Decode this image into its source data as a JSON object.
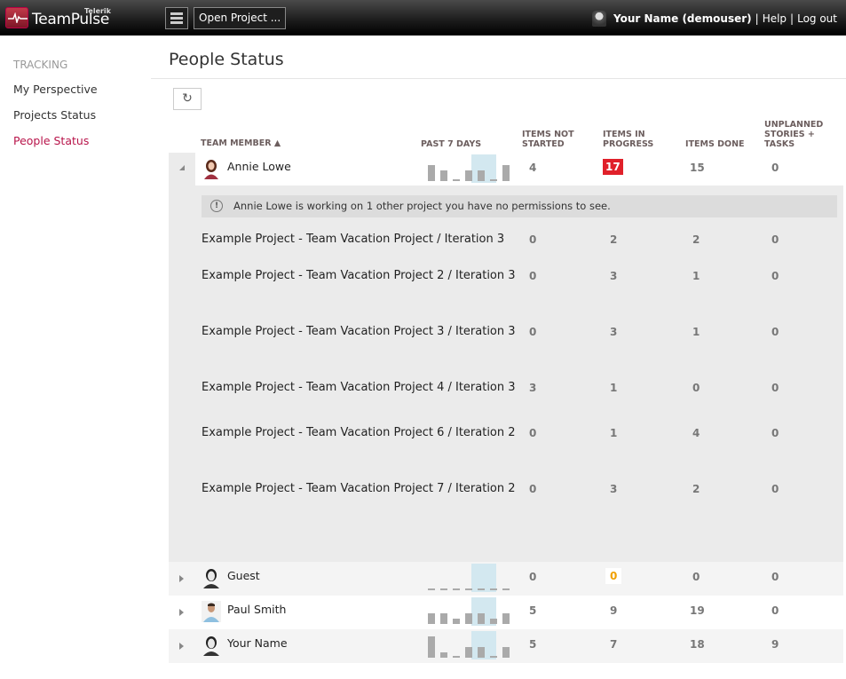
{
  "topbar": {
    "brand": "TeamPulse",
    "brand_sub": "Telerik",
    "open_project": "Open Project ...",
    "user": "Your Name (demouser)",
    "sep": "|",
    "help": "Help",
    "logout": "Log out"
  },
  "sidebar": {
    "heading": "TRACKING",
    "items": [
      {
        "label": "My Perspective"
      },
      {
        "label": "Projects Status"
      },
      {
        "label": "People Status",
        "active": true
      }
    ]
  },
  "page": {
    "title": "People Status",
    "refresh_icon": "↻"
  },
  "table": {
    "headers": {
      "member": "TEAM MEMBER ▲",
      "past7": "PAST 7 DAYS",
      "not_started": [
        "ITEMS NOT",
        "STARTED"
      ],
      "in_progress": [
        "ITEMS IN",
        "PROGRESS"
      ],
      "done": "ITEMS DONE",
      "unplanned": [
        "UNPLANNED",
        "STORIES +",
        "TASKS"
      ]
    },
    "members": [
      {
        "name": "Annie Lowe",
        "expanded": true,
        "spark": [
          3,
          2,
          0,
          2,
          2,
          0,
          3
        ],
        "not_started": "4",
        "in_progress": "17",
        "in_progress_style": "red",
        "done": "15",
        "unplanned": "0"
      },
      {
        "name": "Guest",
        "expanded": false,
        "spark": [
          0,
          0,
          0,
          0,
          0,
          0,
          0
        ],
        "not_started": "0",
        "in_progress": "0",
        "in_progress_style": "orange",
        "done": "0",
        "unplanned": "0"
      },
      {
        "name": "Paul Smith",
        "expanded": false,
        "spark": [
          2,
          2,
          1,
          2,
          2,
          1,
          2
        ],
        "not_started": "5",
        "in_progress": "9",
        "done": "19",
        "unplanned": "0"
      },
      {
        "name": "Your Name",
        "expanded": false,
        "spark": [
          4,
          1,
          0,
          2,
          2,
          0,
          2
        ],
        "not_started": "5",
        "in_progress": "7",
        "done": "18",
        "unplanned": "9"
      }
    ],
    "expanded_detail": {
      "notice": "Annie Lowe is working on 1 other project you have no permissions to see.",
      "notice_icon": "!",
      "projects": [
        {
          "name": "Example Project - Team Vacation Project / Iteration 3",
          "not_started": "0",
          "in_progress": "2",
          "done": "2",
          "unplanned": "0"
        },
        {
          "name": "Example Project - Team Vacation Project 2 / Iteration 3",
          "not_started": "0",
          "in_progress": "3",
          "done": "1",
          "unplanned": "0"
        },
        {
          "name": "Example Project - Team Vacation Project 3 / Iteration 3",
          "not_started": "0",
          "in_progress": "3",
          "done": "1",
          "unplanned": "0"
        },
        {
          "name": "Example Project - Team Vacation Project 4 / Iteration 3",
          "not_started": "3",
          "in_progress": "1",
          "done": "0",
          "unplanned": "0"
        },
        {
          "name": "Example Project - Team Vacation Project 6 / Iteration 2",
          "not_started": "0",
          "in_progress": "1",
          "done": "4",
          "unplanned": "0"
        },
        {
          "name": "Example Project - Team Vacation Project 7 / Iteration 2",
          "not_started": "0",
          "in_progress": "3",
          "done": "2",
          "unplanned": "0"
        }
      ]
    }
  }
}
